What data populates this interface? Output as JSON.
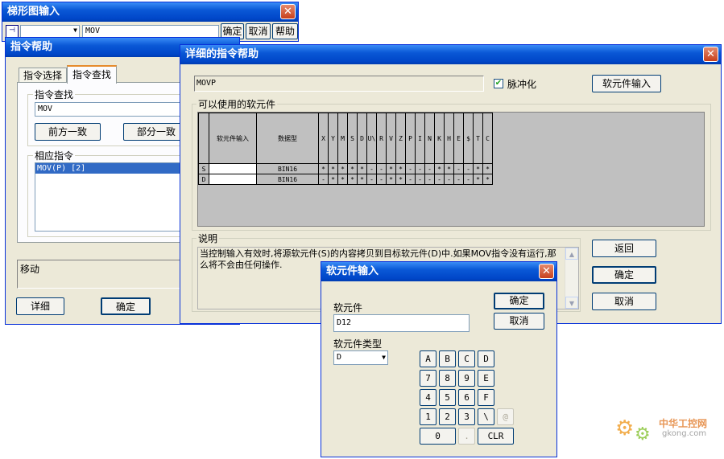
{
  "ladder_window": {
    "title": "梯形图输入",
    "input_value": "MOV",
    "ok": "确定",
    "cancel": "取消",
    "help": "帮助"
  },
  "help_window": {
    "title": "指令帮助",
    "tabs": [
      "指令选择",
      "指令查找"
    ],
    "find_group": "指令查找",
    "find_value": "MOV",
    "btn_forward": "前方一致",
    "btn_partial": "部分一致",
    "result_group": "相应指令",
    "result_item": "MOV(P) [2]",
    "desc": "移动",
    "btn_detail": "详细",
    "btn_ok": "确定"
  },
  "detail_window": {
    "title": "详细的指令帮助",
    "instruction": "MOVP",
    "pulse_label": "脉冲化",
    "pulse_checked": true,
    "device_input_btn": "软元件输入",
    "device_group": "可以使用的软元件",
    "table": {
      "col_input": "软元件输入",
      "col_type": "数据型",
      "device_cols": [
        "X",
        "Y",
        "M",
        "S",
        "D",
        "U\\",
        "R",
        "V",
        "Z",
        "P",
        "I",
        "N",
        "K",
        "H",
        "E",
        "$",
        "T",
        "C"
      ],
      "rows": [
        {
          "name": "S",
          "type": "BIN16",
          "marks": [
            "*",
            "*",
            "*",
            "*",
            "*",
            "-",
            "-",
            "*",
            "*",
            "-",
            "-",
            "-",
            "*",
            "*",
            "-",
            "-",
            "*",
            "*"
          ]
        },
        {
          "name": "D",
          "type": "BIN16",
          "marks": [
            "-",
            "*",
            "*",
            "*",
            "*",
            "-",
            "-",
            "*",
            "*",
            "-",
            "-",
            "-",
            "-",
            "-",
            "-",
            "-",
            "*",
            "*"
          ]
        }
      ]
    },
    "explain_group": "说明",
    "explain_text": "当控制输入有效时,将源软元件(S)的内容拷贝到目标软元件(D)中.如果MOV指令没有运行,那么将不会由任何操作.",
    "btn_back": "返回",
    "btn_ok": "确定",
    "btn_cancel": "取消"
  },
  "device_dialog": {
    "title": "软元件输入",
    "device_label": "软元件",
    "device_value": "D12",
    "ok": "确定",
    "cancel": "取消",
    "type_label": "软元件类型",
    "type_value": "D",
    "keys": [
      [
        "A",
        "B",
        "C",
        "D"
      ],
      [
        "7",
        "8",
        "9",
        "E"
      ],
      [
        "4",
        "5",
        "6",
        "F"
      ],
      [
        "1",
        "2",
        "3",
        "\\",
        "@"
      ]
    ],
    "key_zero": "0",
    "key_dot": ".",
    "key_clr": "CLR"
  },
  "watermark": {
    "brand": "中华工控网",
    "domain": "gkong.com"
  }
}
